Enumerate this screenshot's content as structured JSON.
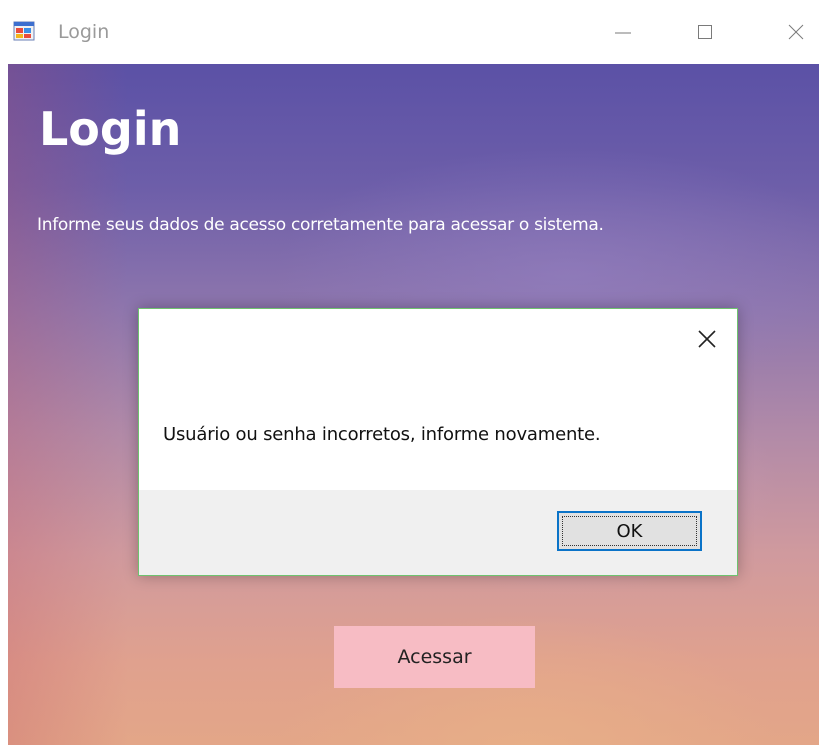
{
  "window": {
    "title": "Login",
    "icon": "windows-forms-app-icon",
    "controls": [
      "minimize-icon",
      "maximize-icon",
      "close-icon"
    ]
  },
  "form": {
    "heading": "Login",
    "subtitle": "Informe seus dados de acesso corretamente para acessar o sistema.",
    "access_button_label": "Acessar"
  },
  "message_box": {
    "message": "Usuário ou senha incorretos, informe novamente.",
    "ok_label": "OK"
  },
  "colors": {
    "access_button": "#f7bcc4",
    "ok_focus_border": "#0a73c8",
    "dialog_border": "#6fc26f"
  }
}
